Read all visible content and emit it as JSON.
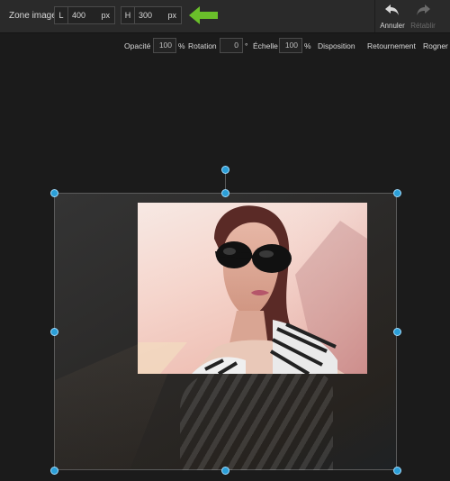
{
  "topbar": {
    "zone_label": "Zone image :",
    "width": {
      "prefix": "L",
      "value": "400",
      "unit": "px"
    },
    "height": {
      "prefix": "H",
      "value": "300",
      "unit": "px"
    },
    "undo_label": "Annuler",
    "redo_label": "Rétablir"
  },
  "toolbar": {
    "opacity_label": "Opacité",
    "opacity_value": "100",
    "opacity_unit": "%",
    "rotation_label": "Rotation",
    "rotation_value": "0",
    "rotation_unit": "°",
    "scale_label": "Échelle",
    "scale_value": "100",
    "scale_unit": "%",
    "disposition_label": "Disposition",
    "flip_label": "Retournement",
    "crop_label": "Rogner"
  },
  "colors": {
    "accent_arrow": "#6abf2a",
    "handle": "#2b9fd8",
    "background": "#1b1b1b",
    "topbar": "#2a2a2a"
  },
  "icons": [
    "undo-icon",
    "redo-icon",
    "pointer-arrow-icon"
  ]
}
